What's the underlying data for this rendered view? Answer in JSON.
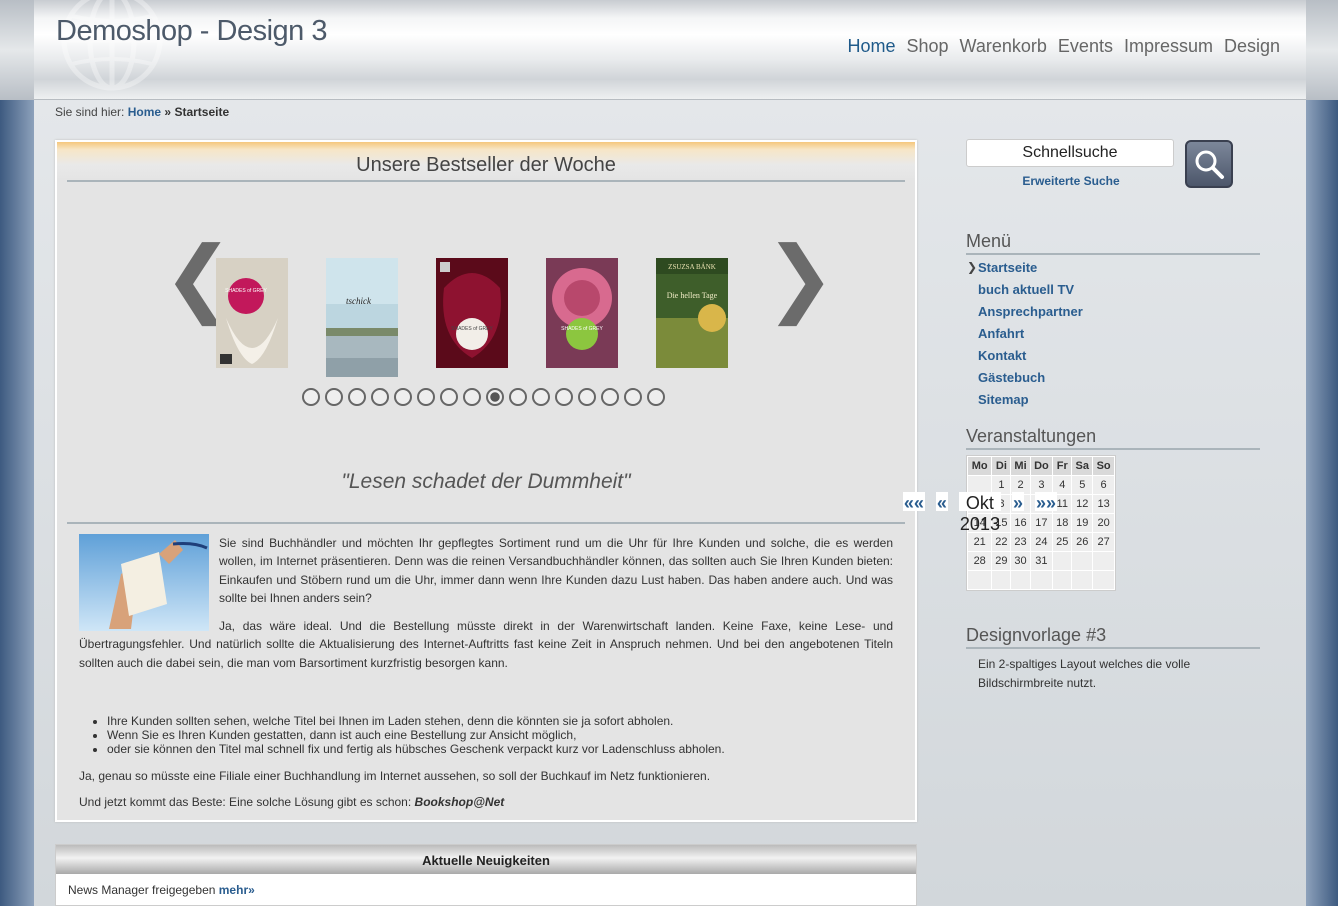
{
  "header": {
    "title": "Demoshop - Design 3",
    "nav": [
      "Home",
      "Shop",
      "Warenkorb",
      "Events",
      "Impressum",
      "Design"
    ],
    "active_index": 0
  },
  "breadcrumb": {
    "prefix": "Sie sind hier:",
    "home": "Home",
    "sep": "»",
    "current": "Startseite"
  },
  "bestseller": {
    "title": "Unsere Bestseller der Woche",
    "prev": "❮",
    "next": "❯",
    "books": [
      {
        "cover": "shades-of-grey-1",
        "title_text": "SHADES of GREY"
      },
      {
        "cover": "tschick",
        "title_text": "tschick"
      },
      {
        "cover": "shades-of-grey-2",
        "title_text": "SHADES of GREY"
      },
      {
        "cover": "shades-of-grey-3",
        "title_text": "SHADES of GREY"
      },
      {
        "cover": "die-hellen-tage",
        "title_text": "Die hellen Tage"
      }
    ],
    "dot_count": 16,
    "active_dot": 8,
    "quote": "\"Lesen schadet der Dummheit\""
  },
  "intro": {
    "p1": "Sie sind Buchhändler und möchten Ihr gepflegtes Sortiment rund um die Uhr für Ihre Kunden und solche, die es werden wollen, im Internet präsentieren. Denn was die reinen Versandbuchhändler können, das sollten auch Sie Ihren Kunden bieten: Einkaufen und Stöbern rund um die Uhr, immer dann wenn Ihre Kunden dazu Lust haben. Das haben andere auch. Und was sollte bei Ihnen anders sein?",
    "p2": "Ja, das wäre ideal. Und die Bestellung müsste direkt in der Warenwirtschaft landen. Keine Faxe, keine Lese- und Übertragungsfehler. Und natürlich sollte die Aktualisierung des Internet-Auftritts fast keine Zeit in Anspruch nehmen. Und bei den angebotenen Titeln sollten auch die dabei sein, die man vom Barsortiment kurzfristig besorgen kann.",
    "bullets": [
      "Ihre Kunden sollten sehen, welche Titel bei Ihnen im Laden stehen, denn die könnten sie ja sofort abholen.",
      "Wenn Sie es Ihren Kunden gestatten, dann ist auch eine Bestellung zur Ansicht möglich,",
      "oder sie können den Titel mal schnell fix und fertig als hübsches Geschenk verpackt kurz vor Ladenschluss abholen."
    ],
    "p3": "Ja, genau so müsste eine Filiale einer Buchhandlung im Internet aussehen, so soll der Buchkauf im Netz funktionieren.",
    "p4": "Und jetzt kommt das Beste: Eine solche Lösung gibt es schon:",
    "p4_brand": "Bookshop@Net"
  },
  "news": {
    "title": "Aktuelle Neuigkeiten",
    "text": "News Manager freigegeben",
    "more": "mehr»"
  },
  "sidebar": {
    "search_placeholder": "Schnellsuche",
    "advanced": "Erweiterte Suche",
    "menu_title": "Menü",
    "menu": [
      "Startseite",
      "buch aktuell TV",
      "Ansprechpartner",
      "Anfahrt",
      "Kontakt",
      "Gästebuch",
      "Sitemap"
    ],
    "events_title": "Veranstaltungen",
    "calendar": {
      "nav": [
        "««",
        "«",
        "Okt 2013",
        "»",
        "»»"
      ],
      "days": [
        "Mo",
        "Di",
        "Mi",
        "Do",
        "Fr",
        "Sa",
        "So"
      ],
      "weeks": [
        [
          "",
          "1",
          "2",
          "3",
          "4",
          "5",
          "6"
        ],
        [
          "7",
          "8",
          "9",
          "10",
          "11",
          "12",
          "13"
        ],
        [
          "14",
          "15",
          "16",
          "17",
          "18",
          "19",
          "20"
        ],
        [
          "21",
          "22",
          "23",
          "24",
          "25",
          "26",
          "27"
        ],
        [
          "28",
          "29",
          "30",
          "31",
          "",
          "",
          ""
        ],
        [
          "",
          "",
          "",
          "",
          "",
          "",
          ""
        ]
      ]
    },
    "design_title": "Designvorlage #3",
    "design_text": "Ein 2-spaltiges Layout welches die volle Bildschirmbreite nutzt."
  },
  "colors": {
    "link": "#2a5d8f",
    "accent_bar": "#f5c77c"
  }
}
